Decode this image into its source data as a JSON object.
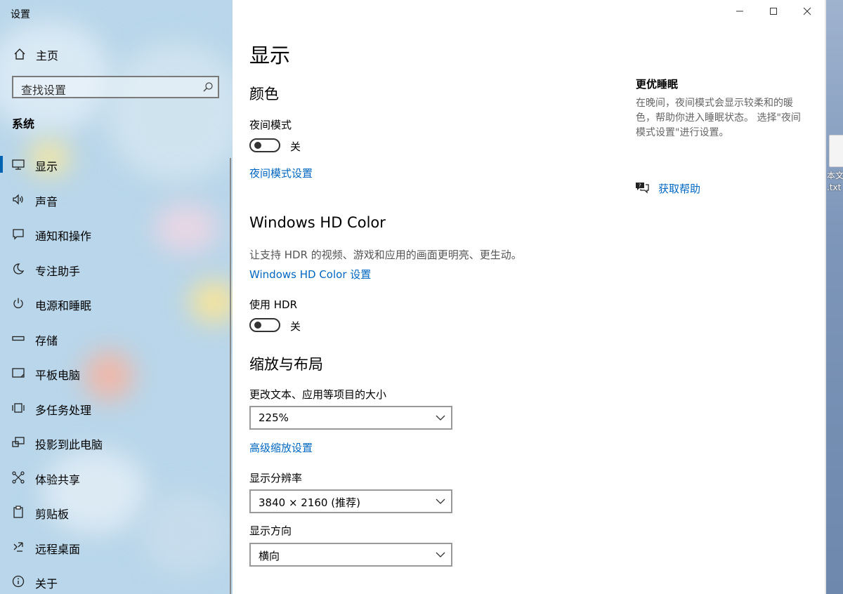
{
  "window": {
    "title": "设置"
  },
  "sidebar": {
    "home_label": "主页",
    "search_placeholder": "查找设置",
    "section_label": "系统",
    "items": [
      {
        "label": "显示",
        "icon": "monitor-icon",
        "active": true
      },
      {
        "label": "声音",
        "icon": "speaker-icon"
      },
      {
        "label": "通知和操作",
        "icon": "notification-icon"
      },
      {
        "label": "专注助手",
        "icon": "moon-icon"
      },
      {
        "label": "电源和睡眠",
        "icon": "power-icon"
      },
      {
        "label": "存储",
        "icon": "storage-icon"
      },
      {
        "label": "平板电脑",
        "icon": "tablet-icon"
      },
      {
        "label": "多任务处理",
        "icon": "multitask-icon"
      },
      {
        "label": "投影到此电脑",
        "icon": "project-icon"
      },
      {
        "label": "体验共享",
        "icon": "share-icon"
      },
      {
        "label": "剪贴板",
        "icon": "clipboard-icon"
      },
      {
        "label": "远程桌面",
        "icon": "remote-icon"
      },
      {
        "label": "关于",
        "icon": "info-icon"
      }
    ]
  },
  "main": {
    "title": "显示",
    "color": {
      "heading": "颜色",
      "night_label": "夜间模式",
      "night_state": "关",
      "night_link": "夜间模式设置"
    },
    "hdr": {
      "heading": "Windows HD Color",
      "desc": "让支持 HDR 的视频、游戏和应用的画面更明亮、更生动。",
      "link": "Windows HD Color 设置",
      "use_label": "使用 HDR",
      "use_state": "关"
    },
    "scale": {
      "heading": "缩放与布局",
      "size_label": "更改文本、应用等项目的大小",
      "size_value": "225%",
      "advanced_link": "高级缩放设置",
      "res_label": "显示分辨率",
      "res_value": "3840 × 2160 (推荐)",
      "orient_label": "显示方向",
      "orient_value": "横向"
    }
  },
  "right_panel": {
    "title": "更优睡眠",
    "desc": "在晚间，夜间模式会显示较柔和的暖色，帮助你进入睡眠状态。 选择\"夜间模式设置\"进行设置。",
    "help_link": "获取帮助"
  },
  "desktop": {
    "file_label": "本文\n.txt"
  },
  "colors": {
    "accent": "#0067c0",
    "sidebar": "#b9d6ea"
  }
}
